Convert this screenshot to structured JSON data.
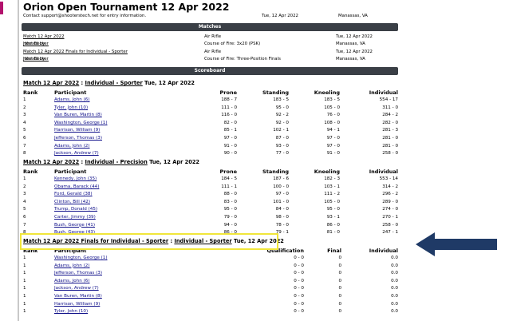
{
  "colors": {
    "header_bar": "#3a3f46",
    "highlight_box": "#f0e63a",
    "arrow": "#1f3a66",
    "link": "#10108a"
  },
  "header": {
    "title": "Orion Open Tournament 12 Apr 2022",
    "contact_prefix": "Contact ",
    "contact_email": "support@shooterstech.net",
    "contact_suffix": " for entry information.",
    "date": "Tue, 12 Apr 2022",
    "location": "Manassas, VA"
  },
  "matches": {
    "bar_label": "Matches",
    "rows": [
      {
        "name": "Match 12 Apr 2022",
        "info": "Air Rifle",
        "date": "Tue, 12 Apr 2022"
      },
      {
        "prefix": "Hosted by ",
        "name": "John Becker",
        "info": "Course of Fire: 3x20 (PSK)",
        "date": "Manassas, VA"
      },
      {
        "name": "Match 12 Apr 2022 Finals for Individual - Sporter",
        "info": "Air Rifle",
        "date": "Tue, 12 Apr 2022"
      },
      {
        "prefix": "Hosted by ",
        "name": "John Becker",
        "info": "Course of Fire: Three-Position Finals",
        "date": "Manassas, VA"
      }
    ]
  },
  "scoreboard": {
    "bar_label": "Scoreboard",
    "sporter": {
      "match_link": "Match 12 Apr 2022",
      "sep": " : ",
      "event_link": "Individual - Sporter",
      "date": " Tue, 12 Apr 2022",
      "headers": {
        "rank": "Rank",
        "participant": "Participant",
        "prone": "Prone",
        "standing": "Standing",
        "kneeling": "Kneeling",
        "individual": "Individual"
      },
      "rows": [
        {
          "rank": "1",
          "name": "Adams, John (6)",
          "prone": "188 - 7",
          "standing": "183 - 5",
          "kneeling": "183 - 5",
          "individual": "554 - 17"
        },
        {
          "rank": "2",
          "name": "Tyler, John (10)",
          "prone": "111 - 0",
          "standing": "95 - 0",
          "kneeling": "105 - 0",
          "individual": "311 - 0"
        },
        {
          "rank": "3",
          "name": "Van Buren, Martin (8)",
          "prone": "116 - 0",
          "standing": "92 - 2",
          "kneeling": "76 - 0",
          "individual": "284 - 2"
        },
        {
          "rank": "4",
          "name": "Washington, George (1)",
          "prone": "82 - 0",
          "standing": "92 - 0",
          "kneeling": "108 - 0",
          "individual": "282 - 0"
        },
        {
          "rank": "5",
          "name": "Harrison, William (9)",
          "prone": "85 - 1",
          "standing": "102 - 1",
          "kneeling": "94 - 1",
          "individual": "281 - 3"
        },
        {
          "rank": "6",
          "name": "Jefferson, Thomas (3)",
          "prone": "97 - 0",
          "standing": "87 - 0",
          "kneeling": "97 - 0",
          "individual": "281 - 0"
        },
        {
          "rank": "7",
          "name": "Adams, John (2)",
          "prone": "91 - 0",
          "standing": "93 - 0",
          "kneeling": "97 - 0",
          "individual": "281 - 0"
        },
        {
          "rank": "8",
          "name": "Jackson, Andrew (7)",
          "prone": "90 - 0",
          "standing": "77 - 0",
          "kneeling": "91 - 0",
          "individual": "258 - 0"
        }
      ]
    },
    "precision": {
      "match_link": "Match 12 Apr 2022",
      "sep": " : ",
      "event_link": "Individual - Precision",
      "date": " Tue, 12 Apr 2022",
      "headers": {
        "rank": "Rank",
        "participant": "Participant",
        "prone": "Prone",
        "standing": "Standing",
        "kneeling": "Kneeling",
        "individual": "Individual"
      },
      "rows": [
        {
          "rank": "1",
          "name": "Kennedy, John (35)",
          "prone": "184 - 5",
          "standing": "187 - 6",
          "kneeling": "182 - 3",
          "individual": "553 - 14"
        },
        {
          "rank": "2",
          "name": "Obama, Barack (44)",
          "prone": "111 - 1",
          "standing": "100 - 0",
          "kneeling": "103 - 1",
          "individual": "314 - 2"
        },
        {
          "rank": "3",
          "name": "Ford, Gerald (38)",
          "prone": "88 - 0",
          "standing": "97 - 0",
          "kneeling": "111 - 2",
          "individual": "296 - 2"
        },
        {
          "rank": "4",
          "name": "Clinton, Bill (42)",
          "prone": "83 - 0",
          "standing": "101 - 0",
          "kneeling": "105 - 0",
          "individual": "289 - 0"
        },
        {
          "rank": "5",
          "name": "Trump, Donald (45)",
          "prone": "95 - 0",
          "standing": "84 - 0",
          "kneeling": "95 - 0",
          "individual": "274 - 0"
        },
        {
          "rank": "6",
          "name": "Carter, Jimmy (39)",
          "prone": "79 - 0",
          "standing": "98 - 0",
          "kneeling": "93 - 1",
          "individual": "270 - 1"
        },
        {
          "rank": "7",
          "name": "Bush, George (41)",
          "prone": "94 - 0",
          "standing": "78 - 0",
          "kneeling": "86 - 0",
          "individual": "258 - 0"
        },
        {
          "rank": "8",
          "name": "Bush, George (43)",
          "prone": "86 - 0",
          "standing": "79 - 1",
          "kneeling": "81 - 0",
          "individual": "247 - 1"
        }
      ]
    },
    "finals": {
      "match_link": "Match 12 Apr 2022 Finals for Individual - Sporter",
      "sep": " : ",
      "event_link": "Individual - Sporter",
      "date": " Tue, 12 Apr 2022",
      "headers": {
        "rank": "Rank",
        "participant": "Participant",
        "qualification": "Qualification",
        "final": "Final",
        "individual": "Individual"
      },
      "rows": [
        {
          "rank": "1",
          "name": "Washington, George (1)",
          "qualification": "0 - 0",
          "final": "0",
          "individual": "0.0"
        },
        {
          "rank": "1",
          "name": "Adams, John (2)",
          "qualification": "0 - 0",
          "final": "0",
          "individual": "0.0"
        },
        {
          "rank": "1",
          "name": "Jefferson, Thomas (3)",
          "qualification": "0 - 0",
          "final": "0",
          "individual": "0.0"
        },
        {
          "rank": "1",
          "name": "Adams, John (6)",
          "qualification": "0 - 0",
          "final": "0",
          "individual": "0.0"
        },
        {
          "rank": "1",
          "name": "Jackson, Andrew (7)",
          "qualification": "0 - 0",
          "final": "0",
          "individual": "0.0"
        },
        {
          "rank": "1",
          "name": "Van Buren, Martin (8)",
          "qualification": "0 - 0",
          "final": "0",
          "individual": "0.0"
        },
        {
          "rank": "1",
          "name": "Harrison, William (9)",
          "qualification": "0 - 0",
          "final": "0",
          "individual": "0.0"
        },
        {
          "rank": "1",
          "name": "Tyler, John (10)",
          "qualification": "0 - 0",
          "final": "0",
          "individual": "0.0"
        }
      ]
    }
  }
}
